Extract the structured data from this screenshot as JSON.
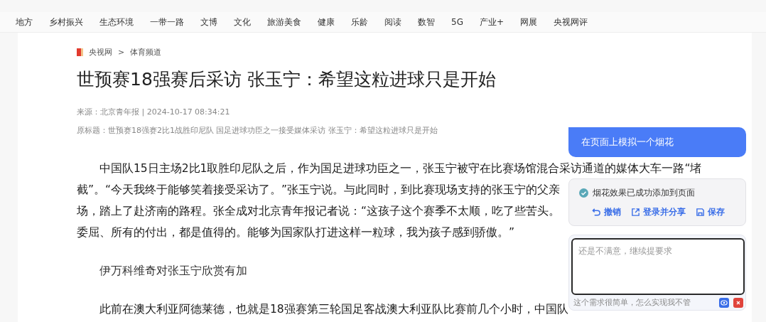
{
  "nav": {
    "items": [
      "地方",
      "乡村振兴",
      "生态环境",
      "一带一路",
      "文博",
      "文化",
      "旅游美食",
      "健康",
      "乐龄",
      "阅读",
      "数智",
      "5G",
      "产业+",
      "网展",
      "央视网评"
    ]
  },
  "breadcrumb": {
    "site": "央视网",
    "separator": ">",
    "channel": "体育频道"
  },
  "article": {
    "title": "世预赛18强赛后采访 张玉宁：希望这粒进球只是开始",
    "meta": "来源：北京青年报 | 2024-10-17 08:34:21",
    "original_title": "原标题：世预赛18强赛2比1战胜印尼队 国足进球功臣之一接受媒体采访 张玉宁：希望这粒进球只是开始",
    "blocks": [
      {
        "kind": "paragraph",
        "lines": [
          "中国队15日主场2比1取胜印尼队之后，作为国足进球功臣之一，张玉宁被守在比赛场馆混合采访通道的媒体大车一路“堵",
          "截”。“今天我终于能够笑着接受采访了。”张玉宁说。与此同时，到比赛现场支持的张玉宁的父亲",
          "场，踏上了赴济南的路程。张全成对北京青年报记者说：“这孩子这个赛季不太顺，吃了些苦头。",
          "委屈、所有的付出，都是值得的。能够为国家队打进这样一粒球，我为孩子感到骄傲。”"
        ]
      },
      {
        "kind": "subheading",
        "lines": [
          "伊万科维奇对张玉宁欣赏有加"
        ]
      },
      {
        "kind": "paragraph",
        "lines": [
          "此前在澳大利亚阿德莱德，也就是18强赛第三轮国足客战澳大利亚队比赛前几个小时，中国队"
        ]
      }
    ]
  },
  "assistant": {
    "prompt": "在页面上模拟一个烟花",
    "result": {
      "message": "烟花效果已成功添加到页面",
      "actions": [
        {
          "kind": "undo",
          "label": "撤销"
        },
        {
          "kind": "share",
          "label": "登录并分享"
        },
        {
          "kind": "save",
          "label": "保存"
        }
      ]
    },
    "input": {
      "placeholder": "还是不满意，继续提要求",
      "suggestion": "这个需求很简单，怎么实现我不管"
    }
  }
}
